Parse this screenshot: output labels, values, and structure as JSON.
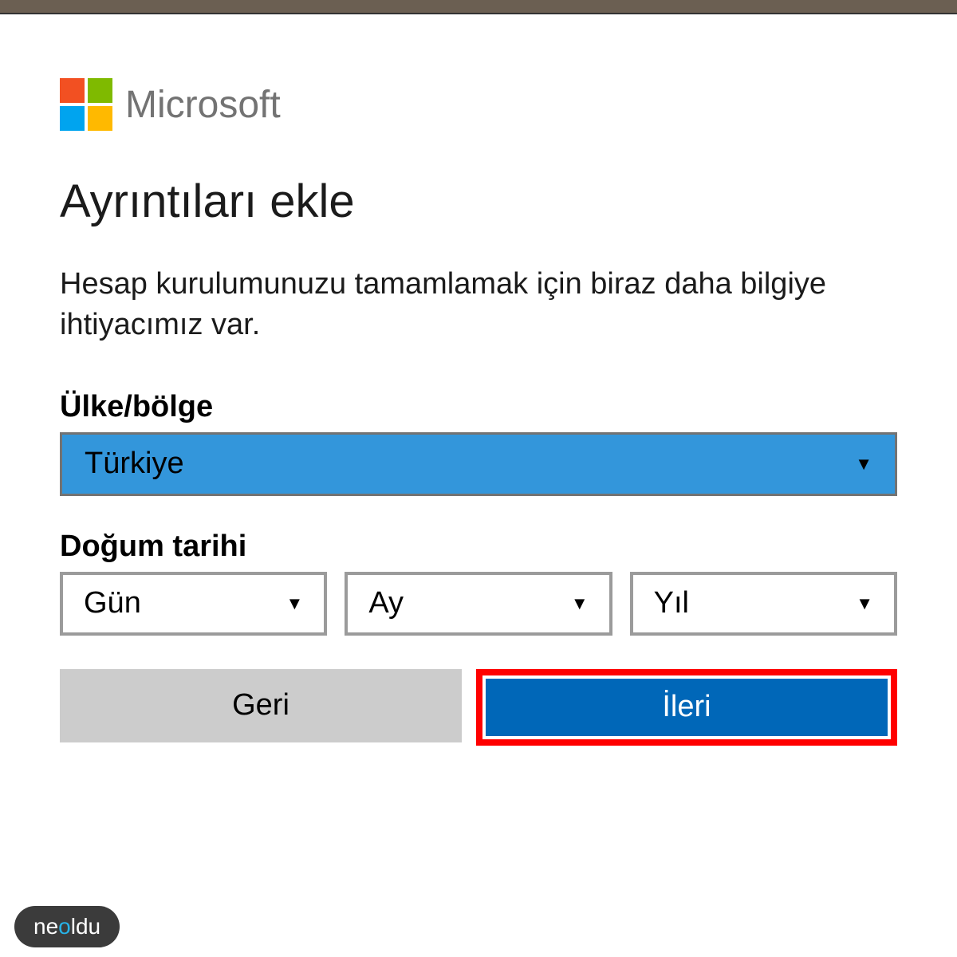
{
  "brand": {
    "name": "Microsoft",
    "logo_colors": {
      "tl": "#f25022",
      "tr": "#7fba00",
      "bl": "#00a4ef",
      "br": "#ffb900"
    }
  },
  "page": {
    "title": "Ayrıntıları ekle",
    "description": "Hesap kurulumunuzu tamamlamak için biraz daha bilgiye ihtiyacımız var."
  },
  "form": {
    "country_label": "Ülke/bölge",
    "country_value": "Türkiye",
    "birthdate_label": "Doğum tarihi",
    "day_value": "Gün",
    "month_value": "Ay",
    "year_value": "Yıl"
  },
  "buttons": {
    "back": "Geri",
    "next": "İleri"
  },
  "watermark": {
    "part1": "ne",
    "accent": "o",
    "part2": "ldu"
  },
  "colors": {
    "primary_button": "#0067b8",
    "highlight_border": "#ff0000",
    "country_select_bg": "#3396db",
    "secondary_button": "#cccccc"
  }
}
